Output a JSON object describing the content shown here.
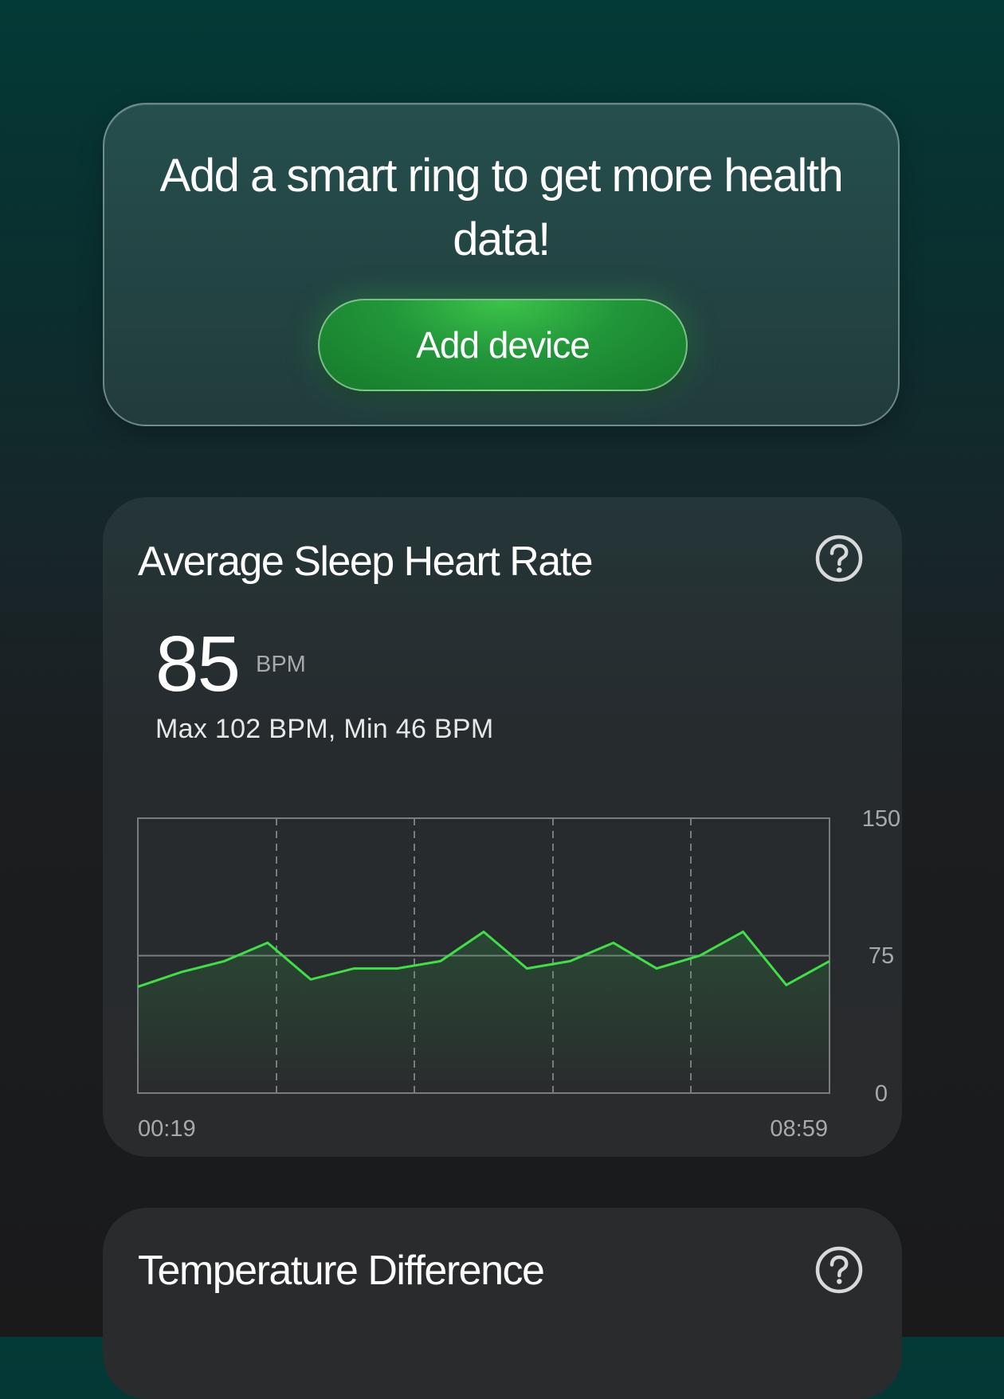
{
  "promo": {
    "message": "Add a smart ring to get more health data!",
    "button_label": "Add device"
  },
  "heart_rate_card": {
    "title": "Average Sleep Heart Rate",
    "help_icon": "question-circle-icon",
    "value": "85",
    "unit": "BPM",
    "range_text": "Max 102 BPM, Min 46 BPM"
  },
  "temperature_card": {
    "title": "Temperature Difference",
    "help_icon": "question-circle-icon"
  },
  "colors": {
    "accent_green": "#3ee045",
    "button_green": "#22963a",
    "card_bg": "#2a2b2d",
    "grid": "#7a7c7f"
  },
  "chart_data": {
    "type": "area",
    "title": "",
    "xlabel": "",
    "ylabel": "",
    "ylim": [
      0,
      150
    ],
    "y_ticks": [
      "150",
      "75",
      "0"
    ],
    "x_tick_labels": [
      "00:19",
      "08:59"
    ],
    "grid": "dashed vertical gridlines, solid line at 75",
    "series": [
      {
        "values": [
          58,
          66,
          72,
          82,
          62,
          68,
          68,
          72,
          88,
          68,
          72,
          82,
          68,
          75,
          88,
          59,
          72
        ]
      }
    ]
  }
}
